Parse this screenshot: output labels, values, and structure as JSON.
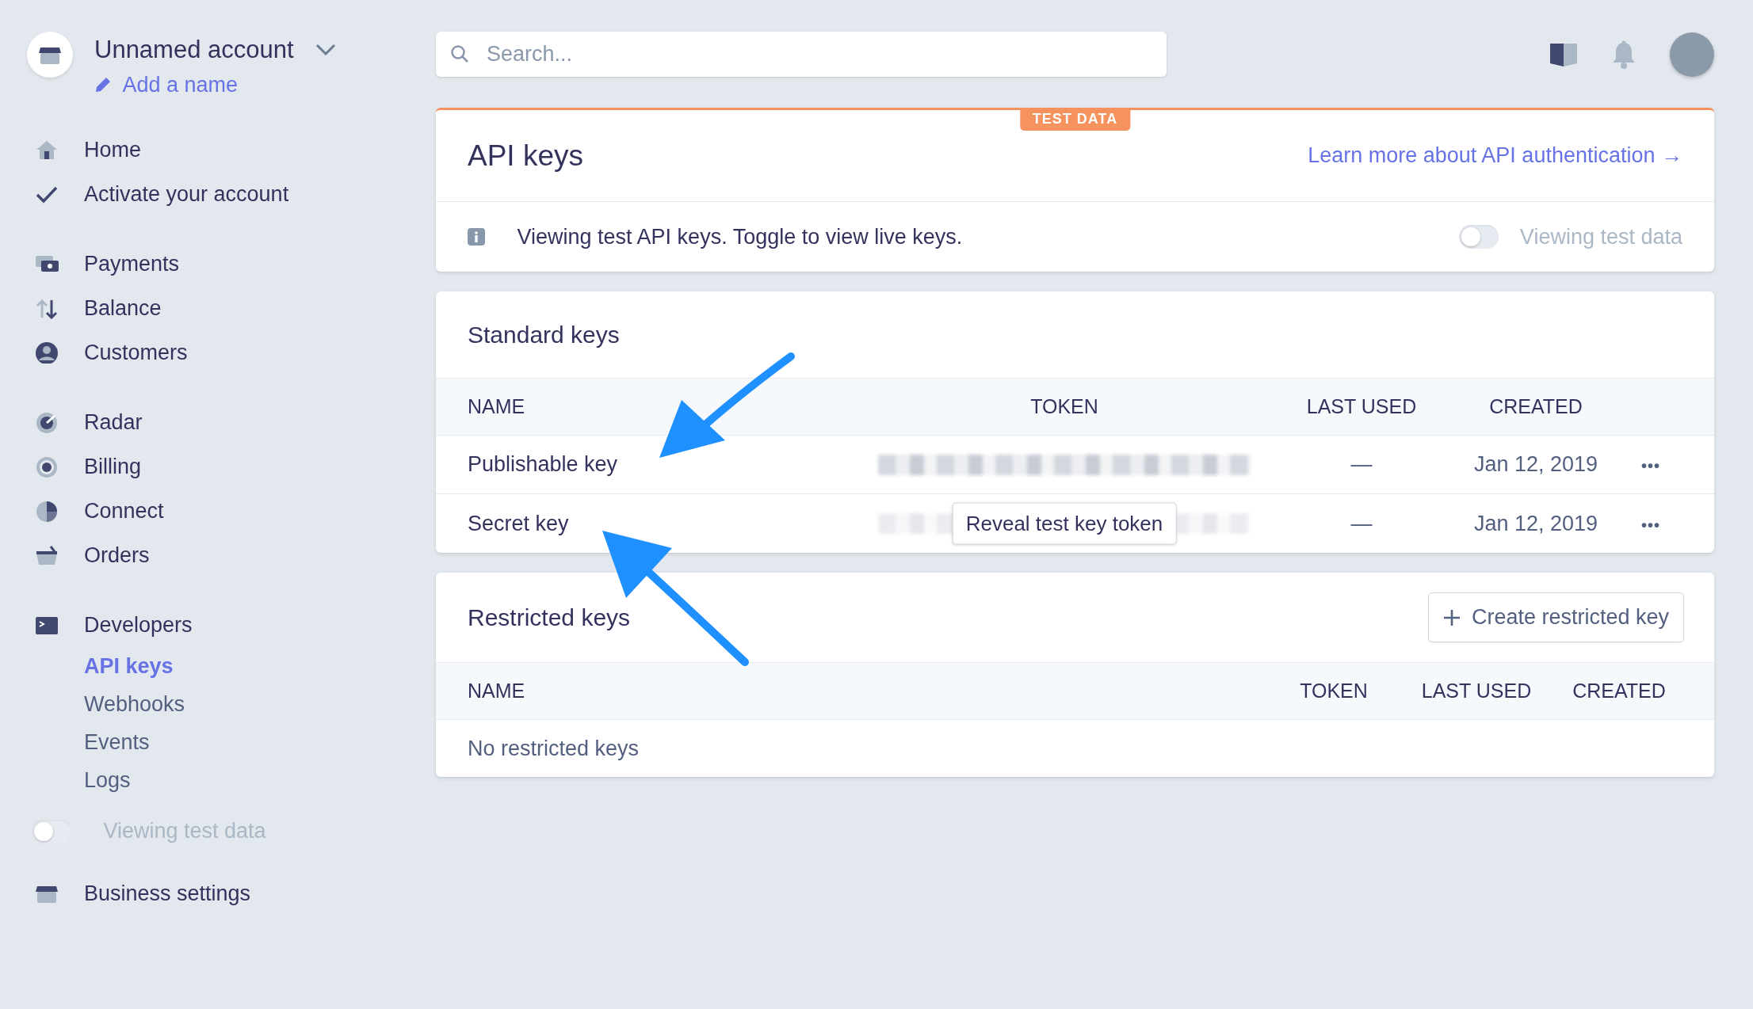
{
  "account": {
    "name": "Unnamed account",
    "edit_link": "Add a name"
  },
  "sidebar": {
    "groups": [
      {
        "items": [
          {
            "label": "Home",
            "selected": false
          },
          {
            "label": "Activate your account",
            "selected": false
          }
        ]
      },
      {
        "items": [
          {
            "label": "Payments",
            "selected": false
          },
          {
            "label": "Balance",
            "selected": false
          },
          {
            "label": "Customers",
            "selected": false
          }
        ]
      },
      {
        "items": [
          {
            "label": "Radar",
            "selected": false
          },
          {
            "label": "Billing",
            "selected": false
          },
          {
            "label": "Connect",
            "selected": false
          },
          {
            "label": "Orders",
            "selected": false
          }
        ]
      },
      {
        "items": [
          {
            "label": "Developers",
            "selected": false,
            "children": [
              {
                "label": "API keys",
                "selected": true
              },
              {
                "label": "Webhooks",
                "selected": false
              },
              {
                "label": "Events",
                "selected": false
              },
              {
                "label": "Logs",
                "selected": false
              }
            ]
          }
        ]
      }
    ],
    "toggle": {
      "label": "Viewing test data",
      "on": false
    },
    "footer_item": {
      "label": "Business settings",
      "selected": false
    }
  },
  "search": {
    "placeholder": "Search..."
  },
  "api_card": {
    "badge": "TEST DATA",
    "title": "API keys",
    "link": "Learn more about API authentication →",
    "notice": "Viewing test API keys. Toggle to view live keys.",
    "toggle": {
      "label": "Viewing test data",
      "on": false
    }
  },
  "standard_keys": {
    "title": "Standard keys",
    "columns": [
      "NAME",
      "TOKEN",
      "LAST USED",
      "CREATED"
    ],
    "rows": [
      {
        "name": "Publishable key",
        "last_used": "—",
        "created": "Jan 12, 2019",
        "more": "•••"
      },
      {
        "name": "Secret key",
        "tooltip": "Reveal test key token",
        "last_used": "—",
        "created": "Jan 12, 2019",
        "more": "•••"
      }
    ]
  },
  "restricted_keys": {
    "title": "Restricted keys",
    "button": "Create restricted key",
    "columns": [
      "NAME",
      "TOKEN",
      "LAST USED",
      "CREATED"
    ],
    "empty": "No restricted keys"
  }
}
